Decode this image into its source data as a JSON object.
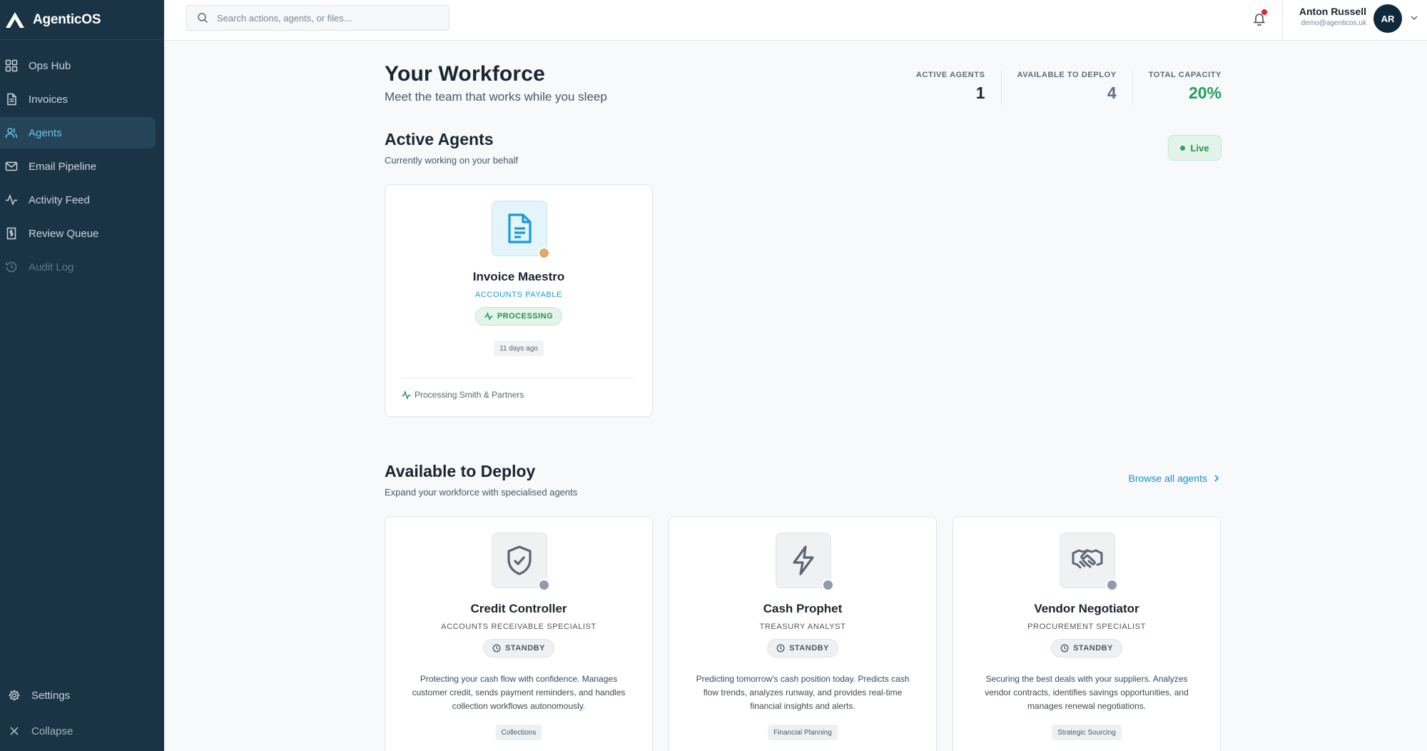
{
  "app": {
    "name": "AgenticOS"
  },
  "sidebar": {
    "items": [
      {
        "label": "Ops Hub",
        "icon": "grid-icon"
      },
      {
        "label": "Invoices",
        "icon": "document-icon"
      },
      {
        "label": "Agents",
        "icon": "users-icon",
        "active": true
      },
      {
        "label": "Email Pipeline",
        "icon": "mail-icon"
      },
      {
        "label": "Activity Feed",
        "icon": "activity-icon"
      },
      {
        "label": "Review Queue",
        "icon": "receipt-icon"
      },
      {
        "label": "Audit Log",
        "icon": "history-icon",
        "muted": true
      }
    ],
    "settings_label": "Settings",
    "collapse_label": "Collapse"
  },
  "topbar": {
    "search_placeholder": "Search actions, agents, or files...",
    "notifications_unread": true,
    "user": {
      "name": "Anton Russell",
      "email": "demo@agenticos.uk",
      "initials": "AR"
    }
  },
  "page": {
    "title": "Your Workforce",
    "subtitle": "Meet the team that works while you sleep",
    "stats": [
      {
        "label": "ACTIVE AGENTS",
        "value": "1",
        "color": "#1b2530"
      },
      {
        "label": "AVAILABLE TO DEPLOY",
        "value": "4",
        "color": "#5d6f80"
      },
      {
        "label": "TOTAL CAPACITY",
        "value": "20%",
        "color": "#22a05a"
      }
    ]
  },
  "active_section": {
    "title": "Active Agents",
    "subtitle": "Currently working on your behalf",
    "badge": "Live",
    "agents": [
      {
        "name": "Invoice Maestro",
        "role": "ACCOUNTS PAYABLE",
        "status": "PROCESSING",
        "last_active": "11 days ago",
        "activity": "Processing Smith & Partners",
        "icon": "document-icon"
      }
    ]
  },
  "deploy_section": {
    "title": "Available to Deploy",
    "subtitle": "Expand your workforce with specialised agents",
    "browse_label": "Browse all agents",
    "agents": [
      {
        "name": "Credit Controller",
        "role": "ACCOUNTS RECEIVABLE SPECIALIST",
        "status": "STANDBY",
        "description": "Protecting your cash flow with confidence. Manages customer credit, sends payment reminders, and handles collection workflows autonomously.",
        "tag": "Collections",
        "icon": "shield-check-icon"
      },
      {
        "name": "Cash Prophet",
        "role": "TREASURY ANALYST",
        "status": "STANDBY",
        "description": "Predicting tomorrow's cash position today. Predicts cash flow trends, analyzes runway, and provides real-time financial insights and alerts.",
        "tag": "Financial Planning",
        "icon": "lightning-icon"
      },
      {
        "name": "Vendor Negotiator",
        "role": "PROCUREMENT SPECIALIST",
        "status": "STANDBY",
        "description": "Securing the best deals with your suppliers. Analyzes vendor contracts, identifies savings opportunities, and manages renewal negotiations.",
        "tag": "Strategic Sourcing",
        "icon": "handshake-icon"
      }
    ]
  }
}
